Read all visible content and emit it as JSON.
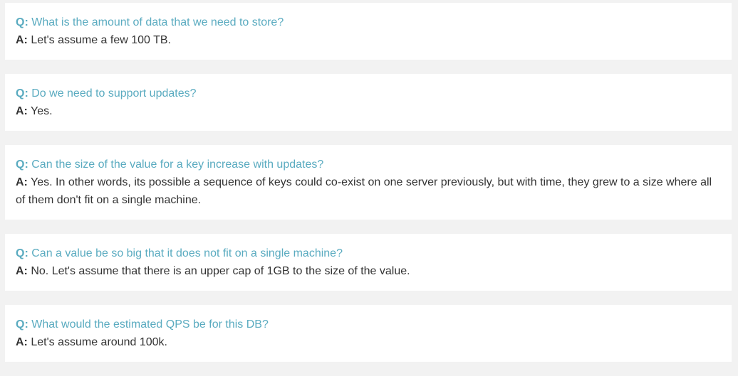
{
  "qa": [
    {
      "q_prefix": "Q:",
      "question": "What is the amount of data that we need to store?",
      "a_prefix": "A:",
      "answer": "Let's assume a few 100 TB."
    },
    {
      "q_prefix": "Q:",
      "question": "Do we need to support updates?",
      "a_prefix": "A:",
      "answer": "Yes."
    },
    {
      "q_prefix": "Q:",
      "question": "Can the size of the value for a key increase with updates?",
      "a_prefix": "A:",
      "answer": "Yes. In other words, its possible a sequence of keys could co-exist on one server previously, but with time, they grew to a size where all of them don't fit on a single machine."
    },
    {
      "q_prefix": "Q:",
      "question": "Can a value be so big that it does not fit on a single machine?",
      "a_prefix": "A:",
      "answer": "No. Let's assume that there is an upper cap of 1GB to the size of the value."
    },
    {
      "q_prefix": "Q:",
      "question": "What would the estimated QPS be for this DB?",
      "a_prefix": "A:",
      "answer": "Let's assume around 100k."
    }
  ],
  "colors": {
    "question": "#5aabc0",
    "answer": "#333333",
    "card_background": "#ffffff",
    "page_background": "#f2f2f2"
  }
}
